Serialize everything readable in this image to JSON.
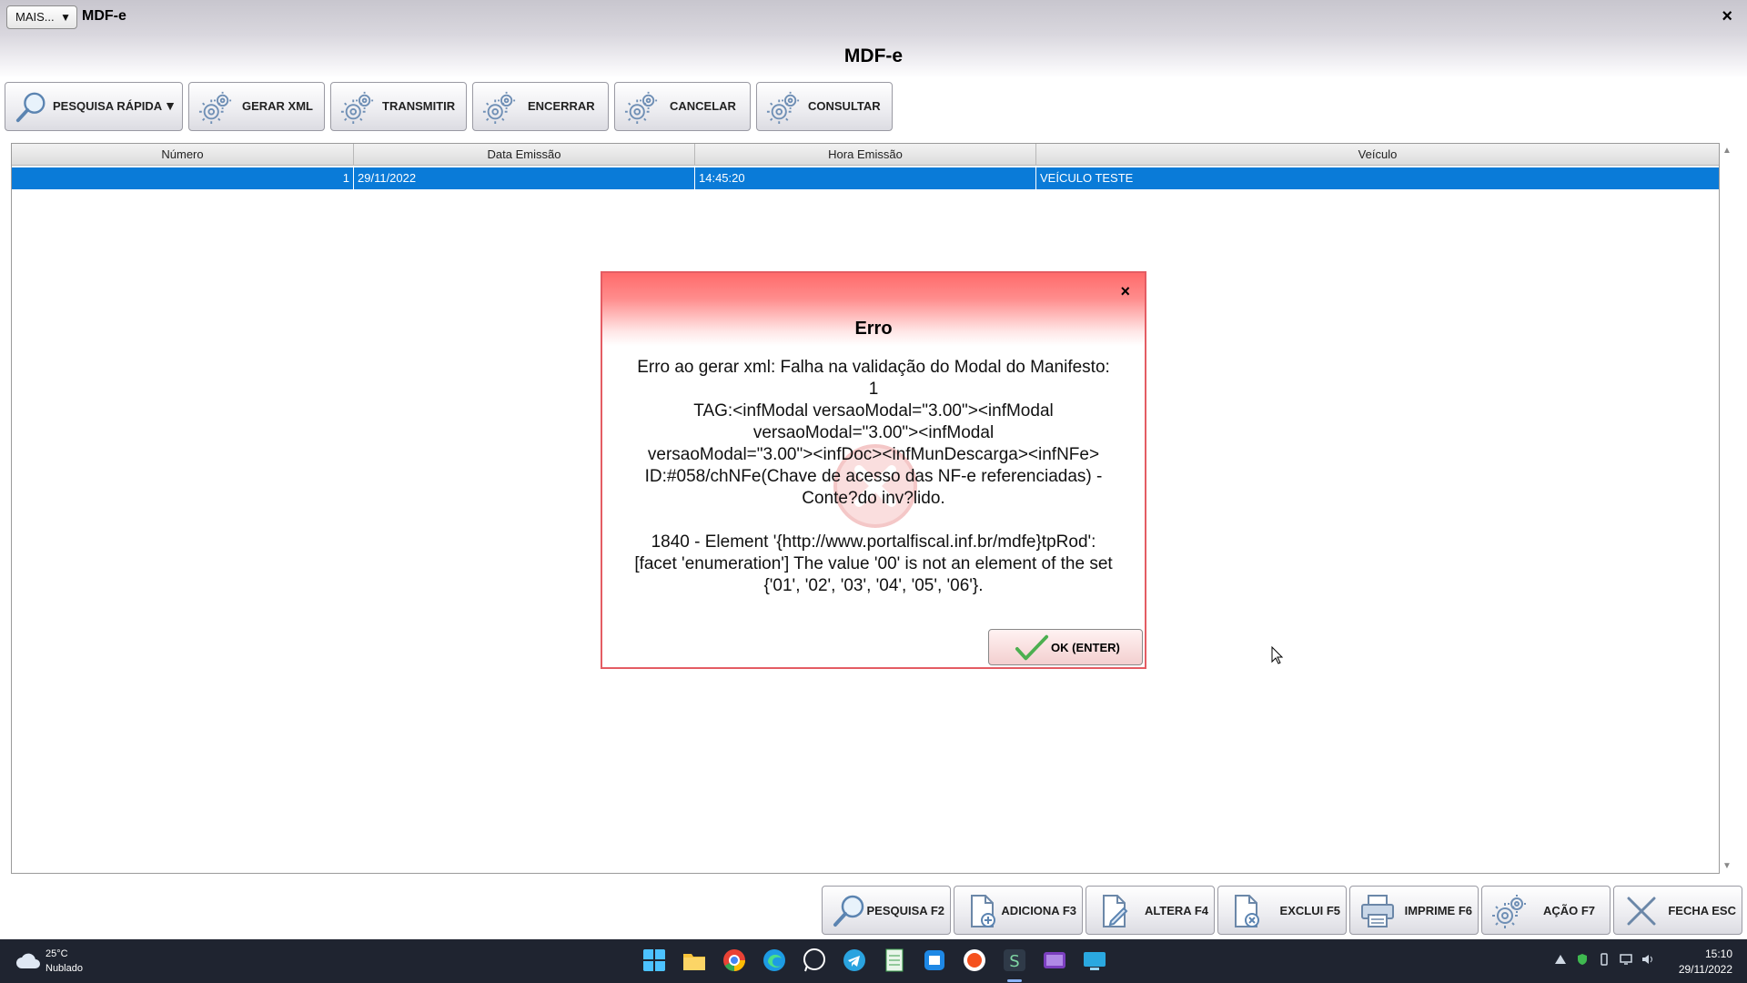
{
  "window": {
    "more_label": "MAIS...",
    "title": "MDF-e",
    "close_glyph": "×"
  },
  "page": {
    "title": "MDF-e"
  },
  "toolbar": {
    "quick_search": "PESQUISA RÁPIDA",
    "generate_xml": "GERAR XML",
    "transmit": "TRANSMITIR",
    "close_manifest": "ENCERRAR",
    "cancel": "CANCELAR",
    "consult": "CONSULTAR"
  },
  "grid": {
    "columns": [
      "Número",
      "Data Emissão",
      "Hora Emissão",
      "Veículo"
    ],
    "rows": [
      {
        "numero": "1",
        "data": "29/11/2022",
        "hora": "14:45:20",
        "veiculo": "VEÍCULO TESTE"
      }
    ]
  },
  "dialog": {
    "title": "Erro",
    "message": "Erro ao gerar xml: Falha na validação do Modal do Manifesto:\n1\nTAG:<infModal versaoModal=\"3.00\"><infModal\nversaoModal=\"3.00\"><infModal\nversaoModal=\"3.00\"><infDoc><infMunDescarga><infNFe>\nID:#058/chNFe(Chave de acesso das NF-e referenciadas) -\nConte?do inv?lido.\n\n1840 - Element '{http://www.portalfiscal.inf.br/mdfe}tpRod':\n[facet 'enumeration'] The value '00' is not an element of the set\n{'01', '02', '03', '04', '05', '06'}.",
    "ok_label": "OK (ENTER)",
    "close_glyph": "×"
  },
  "actions": {
    "search": "PESQUISA F2",
    "add": "ADICIONA F3",
    "edit": "ALTERA F4",
    "delete": "EXCLUI F5",
    "print": "IMPRIME F6",
    "action": "AÇÃO F7",
    "close": "FECHA ESC"
  },
  "taskbar": {
    "weather_temp": "25°C",
    "weather_condition": "Nublado",
    "time": "15:10",
    "date": "29/11/2022"
  },
  "colors": {
    "selection": "#0a7bd8",
    "dialog_header": "#ff6b6b",
    "dialog_border": "#e45c63",
    "taskbar": "#1f2430"
  },
  "icons": {
    "toolbar": [
      "magnifier-icon",
      "gear-icon"
    ],
    "actions": [
      "magnifier-icon",
      "document-add-icon",
      "document-edit-icon",
      "document-delete-icon",
      "printer-icon",
      "gear-icon",
      "close-x-icon"
    ],
    "dialog": [
      "checkmark-icon",
      "error-watermark-icon"
    ]
  }
}
